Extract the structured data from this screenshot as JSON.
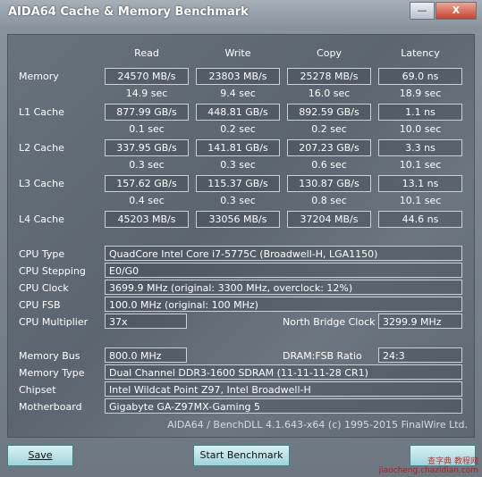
{
  "window": {
    "title": "AIDA64 Cache & Memory Benchmark",
    "minimize_label": "—",
    "close_label": "X"
  },
  "columns": {
    "read": "Read",
    "write": "Write",
    "copy": "Copy",
    "latency": "Latency"
  },
  "rows": [
    {
      "label": "Memory",
      "read": "24570 MB/s",
      "write": "23803 MB/s",
      "copy": "25278 MB/s",
      "latency": "69.0 ns",
      "read_time": "14.9 sec",
      "write_time": "9.4 sec",
      "copy_time": "16.0 sec",
      "latency_time": "18.9 sec"
    },
    {
      "label": "L1 Cache",
      "read": "877.99 GB/s",
      "write": "448.81 GB/s",
      "copy": "892.59 GB/s",
      "latency": "1.1 ns",
      "read_time": "0.1 sec",
      "write_time": "0.2 sec",
      "copy_time": "0.2 sec",
      "latency_time": "10.0 sec"
    },
    {
      "label": "L2 Cache",
      "read": "337.95 GB/s",
      "write": "141.81 GB/s",
      "copy": "207.23 GB/s",
      "latency": "3.3 ns",
      "read_time": "0.3 sec",
      "write_time": "0.3 sec",
      "copy_time": "0.6 sec",
      "latency_time": "10.1 sec"
    },
    {
      "label": "L3 Cache",
      "read": "157.62 GB/s",
      "write": "115.37 GB/s",
      "copy": "130.87 GB/s",
      "latency": "13.1 ns",
      "read_time": "0.4 sec",
      "write_time": "0.3 sec",
      "copy_time": "0.8 sec",
      "latency_time": "10.1 sec"
    },
    {
      "label": "L4 Cache",
      "read": "45203 MB/s",
      "write": "33056 MB/s",
      "copy": "37204 MB/s",
      "latency": "44.6 ns"
    }
  ],
  "info": {
    "cpu_type_label": "CPU Type",
    "cpu_type": "QuadCore Intel Core i7-5775C  (Broadwell-H, LGA1150)",
    "cpu_stepping_label": "CPU Stepping",
    "cpu_stepping": "E0/G0",
    "cpu_clock_label": "CPU Clock",
    "cpu_clock": "3699.9 MHz  (original: 3300 MHz, overclock: 12%)",
    "cpu_fsb_label": "CPU FSB",
    "cpu_fsb": "100.0 MHz  (original: 100 MHz)",
    "cpu_multiplier_label": "CPU Multiplier",
    "cpu_multiplier": "37x",
    "nb_clock_label": "North Bridge Clock",
    "nb_clock": "3299.9 MHz",
    "memory_bus_label": "Memory Bus",
    "memory_bus": "800.0 MHz",
    "dram_fsb_label": "DRAM:FSB Ratio",
    "dram_fsb": "24:3",
    "memory_type_label": "Memory Type",
    "memory_type": "Dual Channel DDR3-1600 SDRAM  (11-11-11-28 CR1)",
    "chipset_label": "Chipset",
    "chipset": "Intel Wildcat Point Z97, Intel Broadwell-H",
    "motherboard_label": "Motherboard",
    "motherboard": "Gigabyte GA-Z97MX-Gaming 5"
  },
  "footer": "AIDA64 / BenchDLL 4.1.643-x64  (c) 1995-2015 FinalWire Ltd.",
  "buttons": {
    "save": "Save",
    "start": "Start Benchmark"
  },
  "watermark": "查字典 教程网\njiaocheng.chazidian.com"
}
